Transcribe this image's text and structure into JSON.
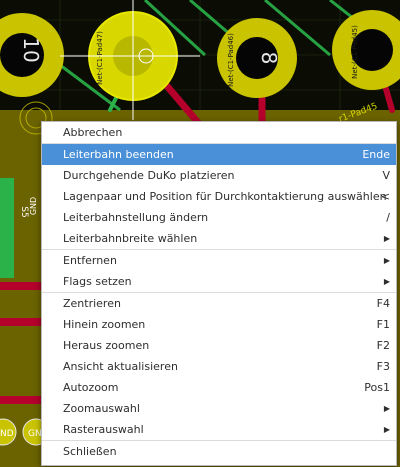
{
  "pcb": {
    "pad_number_1": "10",
    "pad_label_1": "Net-(C1-Pad47)",
    "pad_label_2": "Net-(C1-Pad46)",
    "pad_number_3": "8",
    "pad_label_3": "Net-(C1-Pad45)",
    "pad_label_side": "r1-Pad45",
    "component_label": "S5",
    "gnd_label": "GND",
    "bottom_gnd_1": "ND",
    "bottom_gnd_2": "GN",
    "colors": {
      "board": "#6b6200",
      "pad": "#c9c300",
      "trace_red": "#b4002b",
      "trace_green": "#2bb34a",
      "hole": "#050505"
    }
  },
  "menu": {
    "items": [
      {
        "label": "Abbrechen",
        "shortcut": "",
        "submenu": false,
        "highlighted": false
      },
      {
        "label": "Leiterbahn beenden",
        "shortcut": "Ende",
        "submenu": false,
        "highlighted": true
      },
      {
        "label": "Durchgehende DuKo platzieren",
        "shortcut": "V",
        "submenu": false,
        "highlighted": false
      },
      {
        "label": "Lagenpaar und Position für Durchkontaktierung auswählen",
        "shortcut": "<",
        "submenu": false,
        "highlighted": false
      },
      {
        "label": "Leiterbahnstellung ändern",
        "shortcut": "/",
        "submenu": false,
        "highlighted": false
      },
      {
        "label": "Leiterbahnbreite wählen",
        "shortcut": "",
        "submenu": true,
        "highlighted": false
      },
      {
        "label": "Entfernen",
        "shortcut": "",
        "submenu": true,
        "highlighted": false
      },
      {
        "label": "Flags setzen",
        "shortcut": "",
        "submenu": true,
        "highlighted": false
      },
      {
        "label": "Zentrieren",
        "shortcut": "F4",
        "submenu": false,
        "highlighted": false
      },
      {
        "label": "Hinein zoomen",
        "shortcut": "F1",
        "submenu": false,
        "highlighted": false
      },
      {
        "label": "Heraus zoomen",
        "shortcut": "F2",
        "submenu": false,
        "highlighted": false
      },
      {
        "label": "Ansicht aktualisieren",
        "shortcut": "F3",
        "submenu": false,
        "highlighted": false
      },
      {
        "label": "Autozoom",
        "shortcut": "Pos1",
        "submenu": false,
        "highlighted": false
      },
      {
        "label": "Zoomauswahl",
        "shortcut": "",
        "submenu": true,
        "highlighted": false
      },
      {
        "label": "Rasterauswahl",
        "shortcut": "",
        "submenu": true,
        "highlighted": false
      },
      {
        "label": "Schließen",
        "shortcut": "",
        "submenu": false,
        "highlighted": false
      }
    ],
    "submenu_arrow": "▶"
  }
}
